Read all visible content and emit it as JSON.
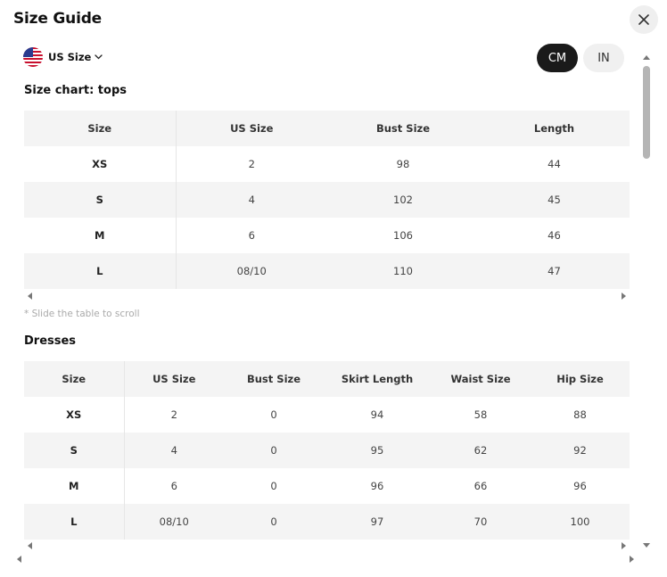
{
  "modal": {
    "title": "Size Guide",
    "close_icon": "close-icon"
  },
  "region": {
    "label": "US Size",
    "flag_icon": "us-flag-icon",
    "chevron_icon": "chevron-down-icon"
  },
  "units": {
    "cm": "CM",
    "in": "IN",
    "selected": "CM"
  },
  "tops": {
    "title": "Size chart: tops",
    "headers": [
      "Size",
      "US Size",
      "Bust Size",
      "Length"
    ],
    "rows": [
      [
        "XS",
        "2",
        "98",
        "44"
      ],
      [
        "S",
        "4",
        "102",
        "45"
      ],
      [
        "M",
        "6",
        "106",
        "46"
      ],
      [
        "L",
        "08/10",
        "110",
        "47"
      ]
    ],
    "scroll_hint": "* Slide the table to scroll"
  },
  "dresses": {
    "title": "Dresses",
    "headers": [
      "Size",
      "US Size",
      "Bust Size",
      "Skirt Length",
      "Waist Size",
      "Hip Size"
    ],
    "rows": [
      [
        "XS",
        "2",
        "0",
        "94",
        "58",
        "88"
      ],
      [
        "S",
        "4",
        "0",
        "95",
        "62",
        "92"
      ],
      [
        "M",
        "6",
        "0",
        "96",
        "66",
        "96"
      ],
      [
        "L",
        "08/10",
        "0",
        "97",
        "70",
        "100"
      ]
    ]
  },
  "colors": {
    "toggle_active": "#1a1a1a",
    "toggle_inactive": "#f0f0f0",
    "row_stripe": "#f4f4f4"
  }
}
